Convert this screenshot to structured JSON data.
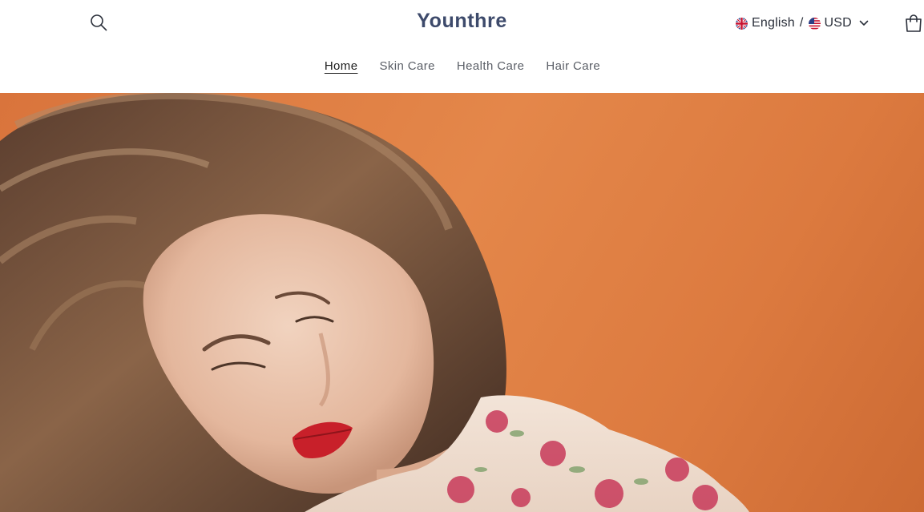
{
  "header": {
    "brand": "Younthre",
    "search_icon": "search-icon",
    "cart_icon": "cart-icon",
    "locale": {
      "language": "English",
      "separator": "/",
      "currency": "USD",
      "language_flag_icon": "uk-flag-icon",
      "currency_flag_icon": "us-flag-icon",
      "dropdown_icon": "chevron-down-icon"
    }
  },
  "nav": {
    "items": [
      {
        "label": "Home",
        "active": true
      },
      {
        "label": "Skin Care",
        "active": false
      },
      {
        "label": "Health Care",
        "active": false
      },
      {
        "label": "Hair Care",
        "active": false
      }
    ]
  },
  "hero": {
    "image": "hero-photo-woman-with-flowing-hair-orange-background"
  },
  "colors": {
    "brand": "#3d4a6b",
    "nav_text": "#5b5f67",
    "hero_background": "#e0813f"
  }
}
